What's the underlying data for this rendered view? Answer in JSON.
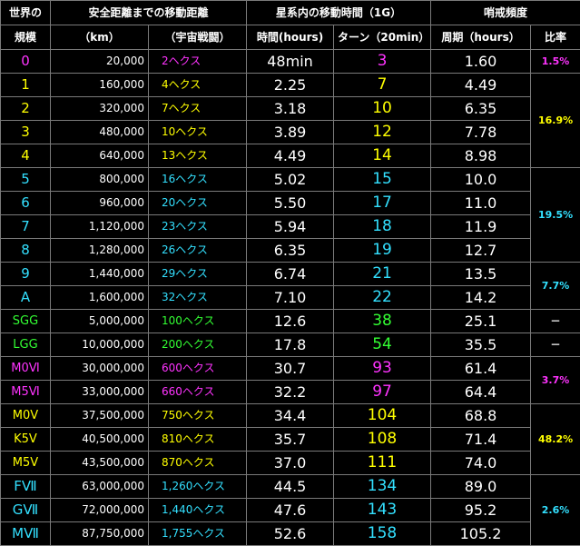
{
  "colors": {
    "magenta": "#ff33ff",
    "yellow": "#ffff00",
    "cyan": "#33e0ff",
    "green": "#33ff33",
    "white": "#ffffff",
    "header_green": "#00e000"
  },
  "header": {
    "r1c0": "世界の",
    "r1c1": "安全距離までの移動距離",
    "r1c3": "星系内の移動時間（1G）",
    "r1c5": "哨戒頻度",
    "r2c0": "規模",
    "r2c1": "（km）",
    "r2c2": "（宇宙戦闘）",
    "r2c3": "時間(hours)",
    "r2c4": "ターン（20min）",
    "r2c5": "周期（hours）",
    "r2c6": "比率"
  },
  "rows": [
    {
      "size": "0",
      "km": "20,000",
      "hex": "2ヘクス",
      "time": "48min",
      "turns": "3",
      "period": "1.60",
      "color": "magenta"
    },
    {
      "size": "1",
      "km": "160,000",
      "hex": "4ヘクス",
      "time": "2.25",
      "turns": "7",
      "period": "4.49",
      "color": "yellow"
    },
    {
      "size": "2",
      "km": "320,000",
      "hex": "7ヘクス",
      "time": "3.18",
      "turns": "10",
      "period": "6.35",
      "color": "yellow"
    },
    {
      "size": "3",
      "km": "480,000",
      "hex": "10ヘクス",
      "time": "3.89",
      "turns": "12",
      "period": "7.78",
      "color": "yellow"
    },
    {
      "size": "4",
      "km": "640,000",
      "hex": "13ヘクス",
      "time": "4.49",
      "turns": "14",
      "period": "8.98",
      "color": "yellow"
    },
    {
      "size": "5",
      "km": "800,000",
      "hex": "16ヘクス",
      "time": "5.02",
      "turns": "15",
      "period": "10.0",
      "color": "cyan"
    },
    {
      "size": "6",
      "km": "960,000",
      "hex": "20ヘクス",
      "time": "5.50",
      "turns": "17",
      "period": "11.0",
      "color": "cyan"
    },
    {
      "size": "7",
      "km": "1,120,000",
      "hex": "23ヘクス",
      "time": "5.94",
      "turns": "18",
      "period": "11.9",
      "color": "cyan"
    },
    {
      "size": "8",
      "km": "1,280,000",
      "hex": "26ヘクス",
      "time": "6.35",
      "turns": "19",
      "period": "12.7",
      "color": "cyan"
    },
    {
      "size": "9",
      "km": "1,440,000",
      "hex": "29ヘクス",
      "time": "6.74",
      "turns": "21",
      "period": "13.5",
      "color": "cyan"
    },
    {
      "size": "A",
      "km": "1,600,000",
      "hex": "32ヘクス",
      "time": "7.10",
      "turns": "22",
      "period": "14.2",
      "color": "cyan"
    },
    {
      "size": "SGG",
      "km": "5,000,000",
      "hex": "100ヘクス",
      "time": "12.6",
      "turns": "38",
      "period": "25.1",
      "color": "green"
    },
    {
      "size": "LGG",
      "km": "10,000,000",
      "hex": "200ヘクス",
      "time": "17.8",
      "turns": "54",
      "period": "35.5",
      "color": "green"
    },
    {
      "size": "M0Ⅵ",
      "km": "30,000,000",
      "hex": "600ヘクス",
      "time": "30.7",
      "turns": "93",
      "period": "61.4",
      "color": "magenta"
    },
    {
      "size": "M5Ⅵ",
      "km": "33,000,000",
      "hex": "660ヘクス",
      "time": "32.2",
      "turns": "97",
      "period": "64.4",
      "color": "magenta"
    },
    {
      "size": "M0Ⅴ",
      "km": "37,500,000",
      "hex": "750ヘクス",
      "time": "34.4",
      "turns": "104",
      "period": "68.8",
      "color": "yellow"
    },
    {
      "size": "K5Ⅴ",
      "km": "40,500,000",
      "hex": "810ヘクス",
      "time": "35.7",
      "turns": "108",
      "period": "71.4",
      "color": "yellow"
    },
    {
      "size": "M5Ⅴ",
      "km": "43,500,000",
      "hex": "870ヘクス",
      "time": "37.0",
      "turns": "111",
      "period": "74.0",
      "color": "yellow"
    },
    {
      "size": "FⅦ",
      "km": "63,000,000",
      "hex": "1,260ヘクス",
      "time": "44.5",
      "turns": "134",
      "period": "89.0",
      "color": "cyan"
    },
    {
      "size": "GⅦ",
      "km": "72,000,000",
      "hex": "1,440ヘクス",
      "time": "47.6",
      "turns": "143",
      "period": "95.2",
      "color": "cyan"
    },
    {
      "size": "MⅦ",
      "km": "87,750,000",
      "hex": "1,755ヘクス",
      "time": "52.6",
      "turns": "158",
      "period": "105.2",
      "color": "cyan"
    }
  ],
  "ratios": [
    {
      "text": "1.5%",
      "color": "magenta",
      "span": 1
    },
    {
      "text": "16.9%",
      "color": "yellow",
      "span": 4
    },
    {
      "text": "19.5%",
      "color": "cyan",
      "span": 4
    },
    {
      "text": "7.7%",
      "color": "cyan",
      "span": 2
    },
    {
      "text": "－",
      "color": "white",
      "span": 1
    },
    {
      "text": "－",
      "color": "white",
      "span": 1
    },
    {
      "text": "3.7%",
      "color": "magenta",
      "span": 2
    },
    {
      "text": "48.2%",
      "color": "yellow",
      "span": 3
    },
    {
      "text": "2.6%",
      "color": "cyan",
      "span": 3
    }
  ]
}
